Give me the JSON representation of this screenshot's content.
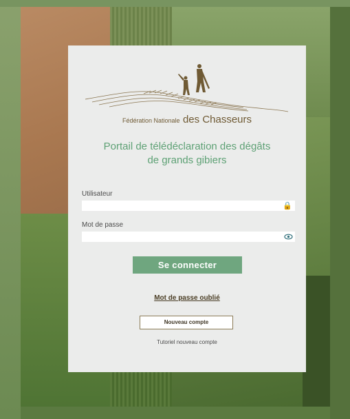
{
  "brand": {
    "small": "Fédération Nationale",
    "big": "des Chasseurs"
  },
  "portal": {
    "title_line1": "Portail de télédéclaration des dégâts",
    "title_line2": "de grands gibiers"
  },
  "form": {
    "user_label": "Utilisateur",
    "user_value": "",
    "user_placeholder": "",
    "user_icon": "lock-icon",
    "password_label": "Mot de passe",
    "password_value": "",
    "password_placeholder": "",
    "password_icon": "eye-icon",
    "login_button": "Se connecter",
    "forgot_link": "Mot de passe oublié",
    "new_account_button": "Nouveau compte",
    "tutorial_link": "Tutoriel nouveau compte"
  },
  "colors": {
    "accent_green": "#6fa67f",
    "title_green": "#5ea175",
    "brand_brown": "#6f5a34",
    "panel_bg": "#ebeceb"
  }
}
